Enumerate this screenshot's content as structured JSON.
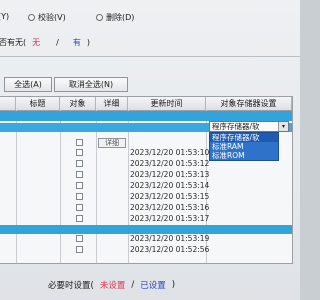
{
  "top_options": [
    {
      "label": "(Y)"
    },
    {
      "label": "校验(V)"
    },
    {
      "label": "删除(D)"
    }
  ],
  "existence": {
    "label": "否有无(",
    "opt_none": "无",
    "slash": "/",
    "opt_has": "有",
    "close": ")"
  },
  "toolbar": {
    "select_all": "全选(A)",
    "unselect_all": "取消全选(N)"
  },
  "table": {
    "headers": [
      "标题",
      "对象",
      "详细",
      "更新时间",
      "对象存储器设置"
    ],
    "detail_label": "详细",
    "timestamps": [
      "2023/12/20 01:53:10",
      "2023/12/20 01:53:12",
      "2023/12/20 01:53:13",
      "2023/12/20 01:53:14",
      "2023/12/20 01:53:15",
      "2023/12/20 01:53:16",
      "2023/12/20 01:53:17",
      "2023/12/20 01:53:19",
      "2023/12/20 01:52:56"
    ]
  },
  "storage_combo": {
    "value": "程序存储器/软",
    "options": [
      "程序存储器/软",
      "标准RAM",
      "标准ROM"
    ]
  },
  "required_time": {
    "label": "必要时设置(",
    "opt_unset": "未设置",
    "slash": "/",
    "opt_set": "已设置",
    "close": ")"
  },
  "colors": {
    "selected_row": "#33a3dc",
    "dropdown_bg": "#2f72c9",
    "accent_red": "#e0304e",
    "accent_blue": "#2b46c4"
  }
}
